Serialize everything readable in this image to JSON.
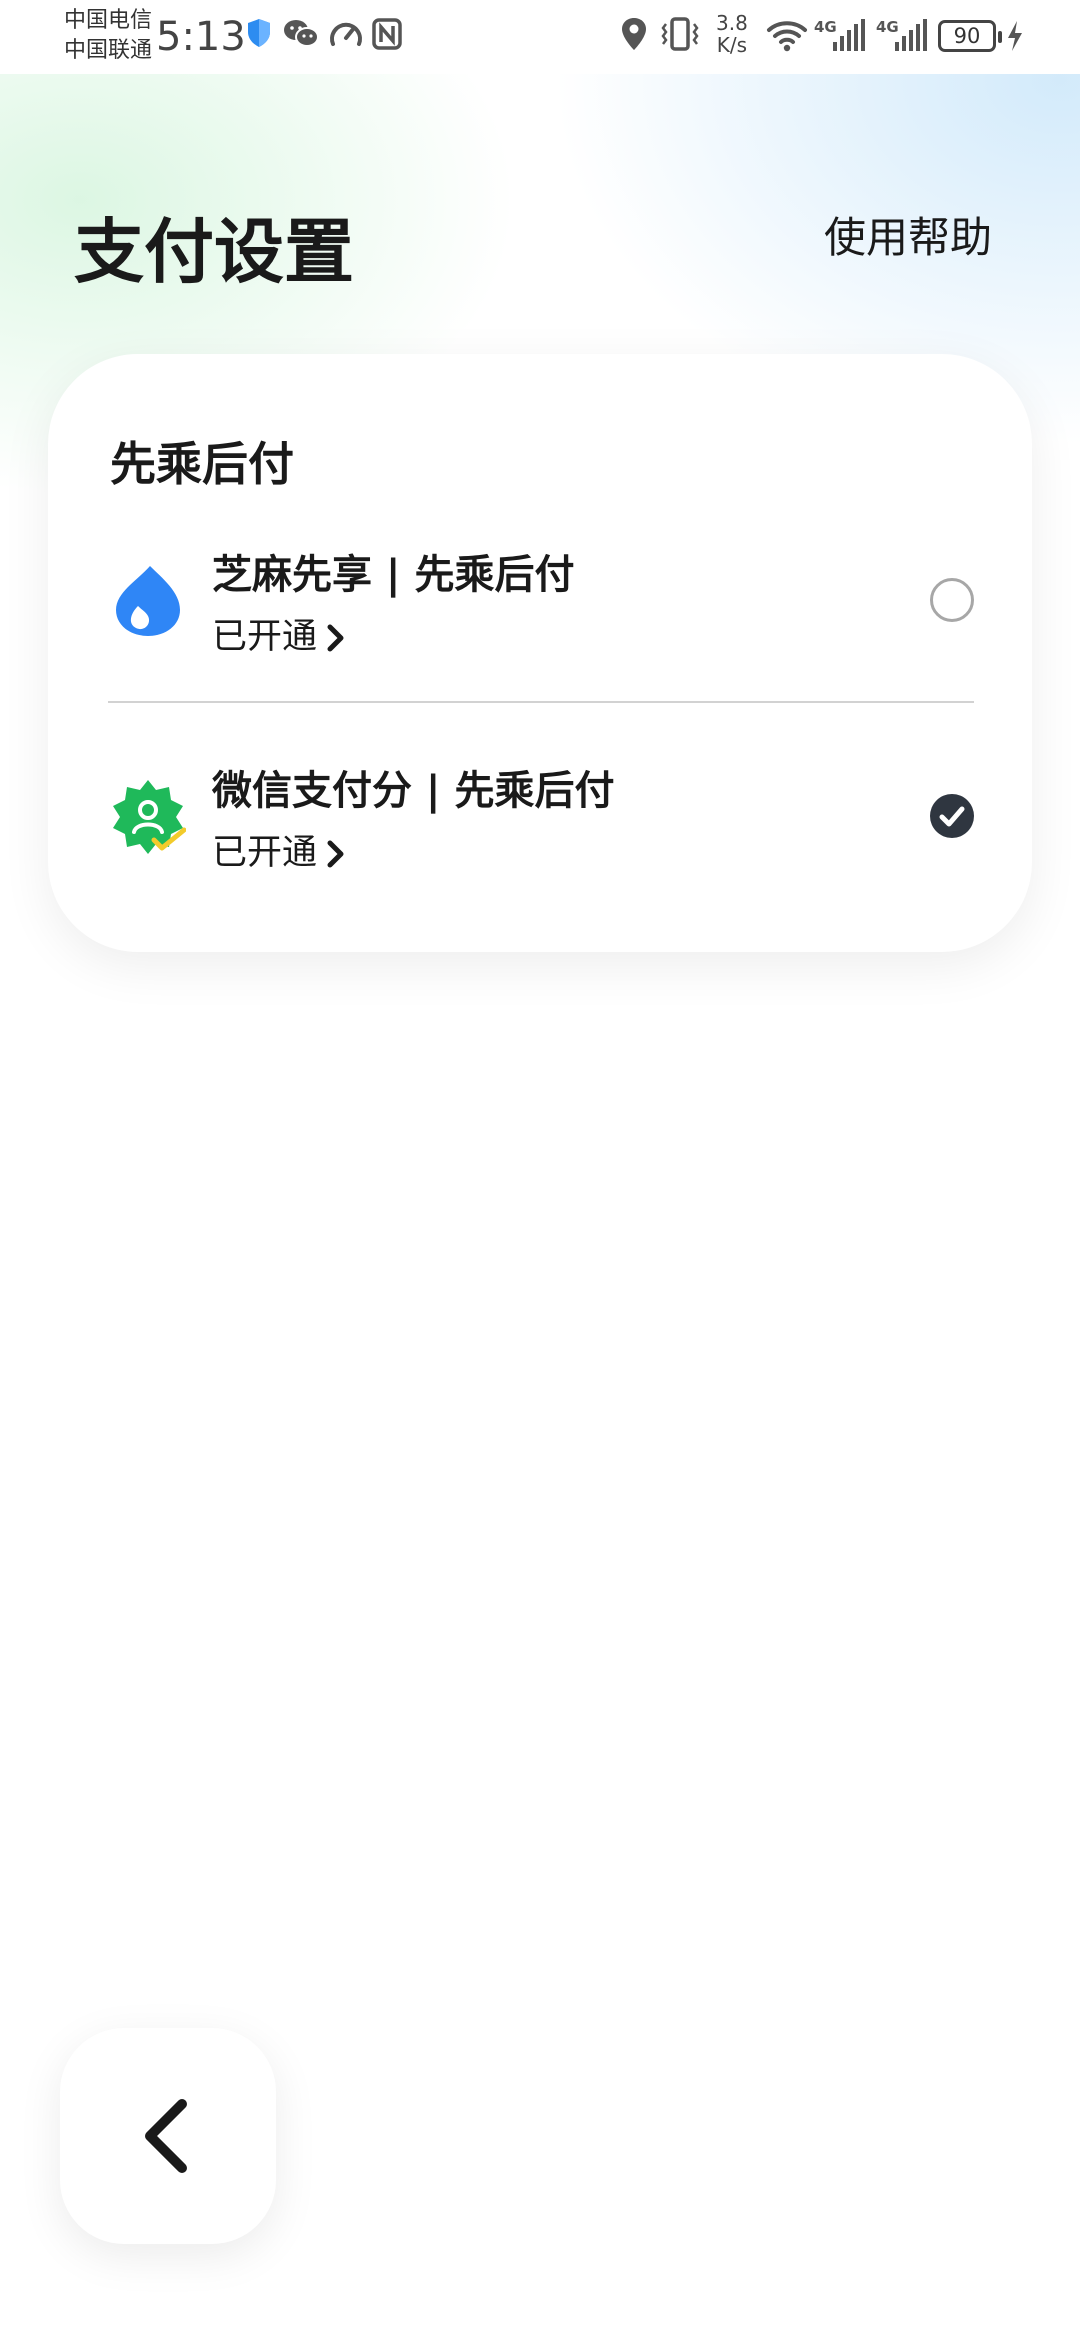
{
  "status_bar": {
    "carrier_1": "中国电信",
    "carrier_2": "中国联通",
    "time": "5:13",
    "net_speed_value": "3.8",
    "net_speed_unit": "K/s",
    "signal_1_label": "4G",
    "signal_2_label": "4G",
    "battery": "90",
    "icons": [
      "shield-icon",
      "wechat-icon",
      "speedometer-icon",
      "nfc-icon",
      "location-icon",
      "vibrate-icon",
      "wifi-icon",
      "signal-icon",
      "battery-icon",
      "charging-icon"
    ]
  },
  "header": {
    "title": "支付设置",
    "help_label": "使用帮助"
  },
  "section": {
    "title": "先乘后付",
    "options": [
      {
        "name": "芝麻先享 | 先乘后付",
        "status": "已开通",
        "icon": "zhima-logo-icon",
        "selected": false,
        "accent": "#2f86f6"
      },
      {
        "name": "微信支付分 | 先乘后付",
        "status": "已开通",
        "icon": "wechat-pay-score-icon",
        "selected": true,
        "accent": "#1fb95a"
      }
    ]
  },
  "nav": {
    "back_icon": "chevron-left-icon"
  }
}
